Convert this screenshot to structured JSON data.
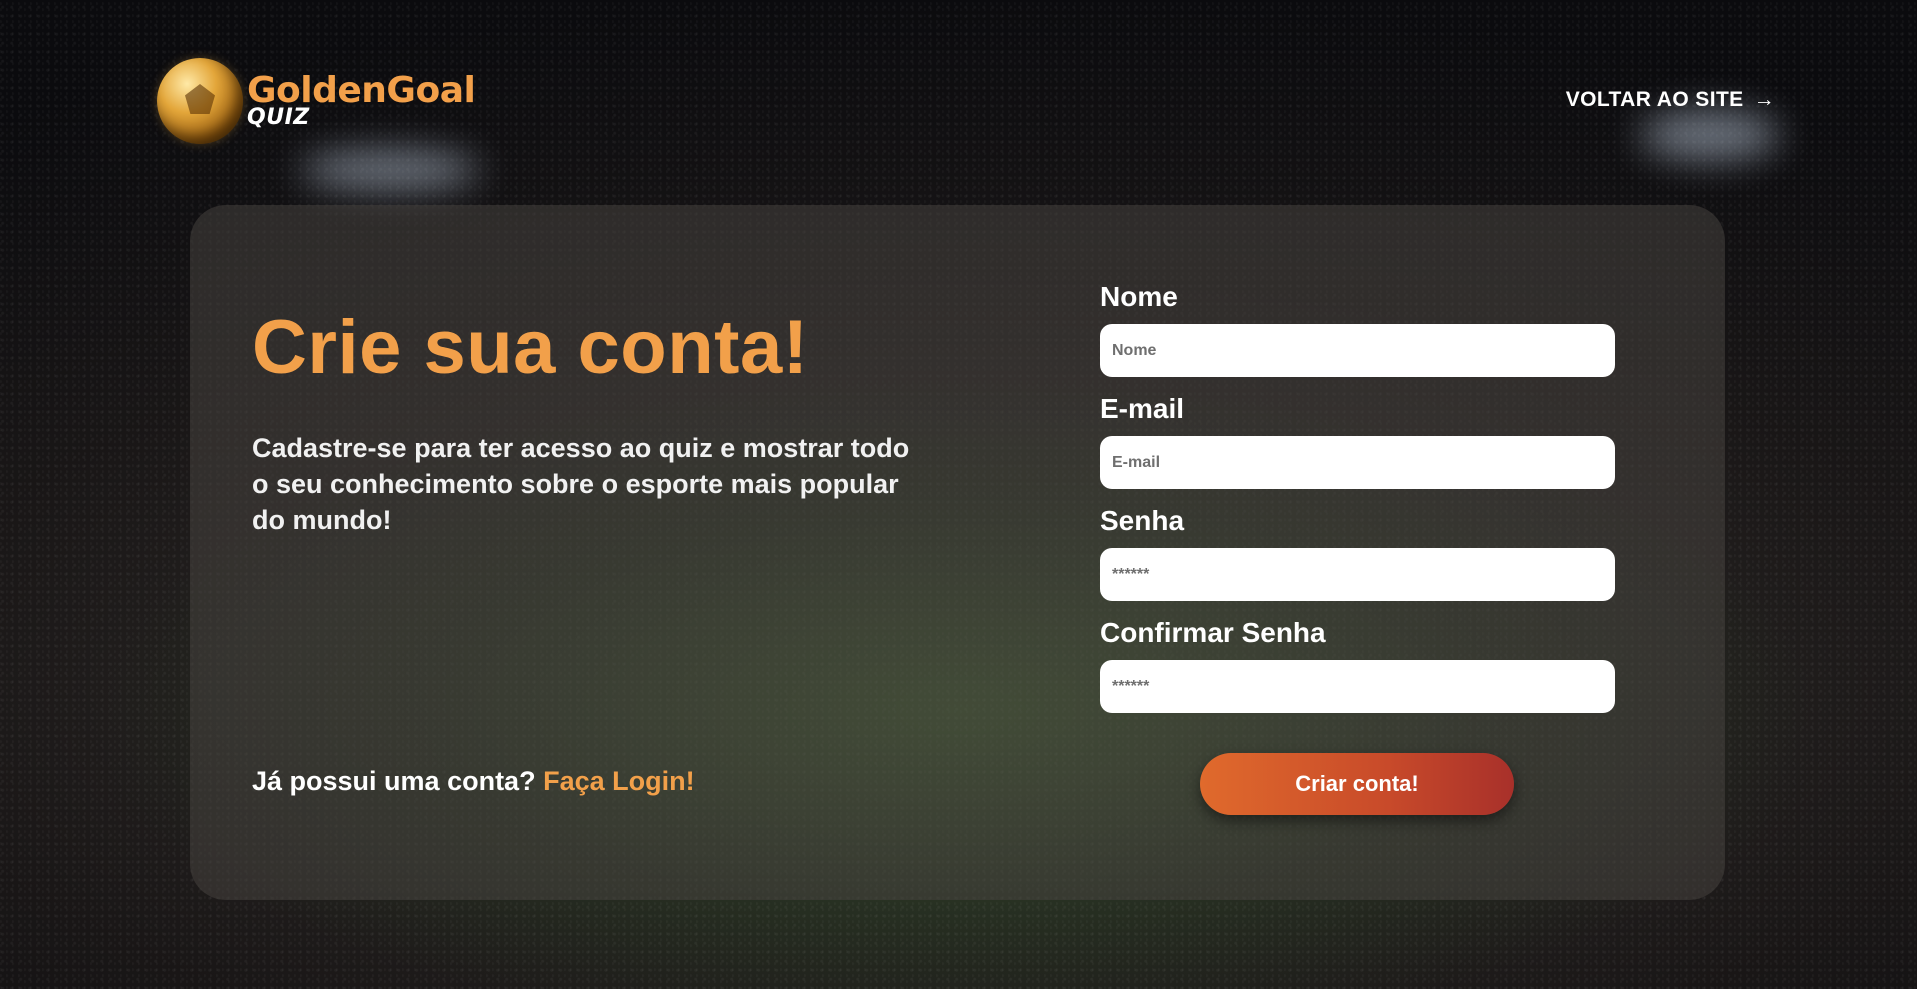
{
  "header": {
    "logo": {
      "icon": "soccer-ball-icon",
      "main_text": "GoldenGoal",
      "sub_text": "QUIZ"
    },
    "back_link": {
      "label": "VOLTAR AO SITE",
      "icon": "arrow-right-icon",
      "icon_glyph": "→"
    }
  },
  "intro": {
    "title": "Crie sua conta!",
    "subtitle": "Cadastre-se para ter acesso ao quiz e mostrar todo o seu conhecimento sobre o esporte mais popular do mundo!",
    "login_prompt": "Já possui uma conta?",
    "login_link": "Faça Login!"
  },
  "form": {
    "name": {
      "label": "Nome",
      "placeholder": "Nome",
      "value": ""
    },
    "email": {
      "label": "E-mail",
      "placeholder": "E-mail",
      "value": ""
    },
    "password": {
      "label": "Senha",
      "placeholder": "******",
      "value": ""
    },
    "confirm_password": {
      "label": "Confirmar Senha",
      "placeholder": "******",
      "value": ""
    },
    "submit_label": "Criar conta!"
  },
  "colors": {
    "accent": "#f2a04a",
    "button_start": "#e06a2c",
    "button_end": "#a8302a",
    "card_bg": "rgba(70,66,62,0.55)"
  }
}
